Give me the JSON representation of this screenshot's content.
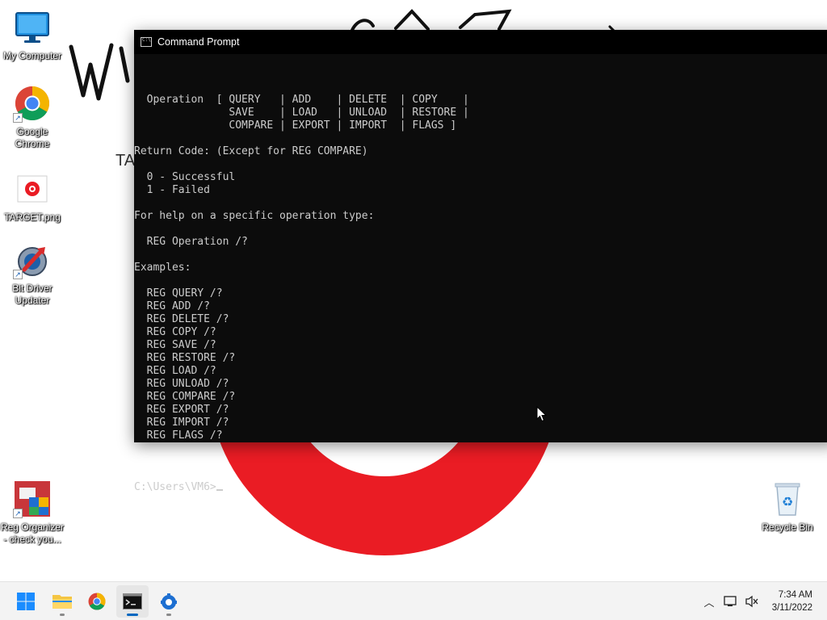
{
  "desktop": {
    "wallpaper_text": "TA",
    "icons": [
      {
        "label": "My Computer"
      },
      {
        "label": "Google Chrome"
      },
      {
        "label": "TARGET.png"
      },
      {
        "label": "Bit Driver Updater"
      },
      {
        "label": "Reg Organizer - check you..."
      },
      {
        "label": "Recycle Bin"
      }
    ]
  },
  "window": {
    "title": "Command Prompt",
    "lines": [
      "  Operation  [ QUERY   | ADD    | DELETE  | COPY    |",
      "               SAVE    | LOAD   | UNLOAD  | RESTORE |",
      "               COMPARE | EXPORT | IMPORT  | FLAGS ]",
      "",
      "Return Code: (Except for REG COMPARE)",
      "",
      "  0 - Successful",
      "  1 - Failed",
      "",
      "For help on a specific operation type:",
      "",
      "  REG Operation /?",
      "",
      "Examples:",
      "",
      "  REG QUERY /?",
      "  REG ADD /?",
      "  REG DELETE /?",
      "  REG COPY /?",
      "  REG SAVE /?",
      "  REG RESTORE /?",
      "  REG LOAD /?",
      "  REG UNLOAD /?",
      "  REG COMPARE /?",
      "  REG EXPORT /?",
      "  REG IMPORT /?",
      "  REG FLAGS /?",
      ""
    ],
    "prompt": "C:\\Users\\VM6>"
  },
  "taskbar": {
    "apps": [
      {
        "name": "start-icon"
      },
      {
        "name": "file-explorer-icon"
      },
      {
        "name": "chrome-icon"
      },
      {
        "name": "command-prompt-icon"
      },
      {
        "name": "bit-driver-updater-icon"
      }
    ],
    "time": "7:34 AM",
    "date": "3/11/2022"
  },
  "colors": {
    "console_bg": "#0c0c0c",
    "console_text": "#cccccc",
    "accent": "#0067c0",
    "target_red": "#ea1c24"
  }
}
